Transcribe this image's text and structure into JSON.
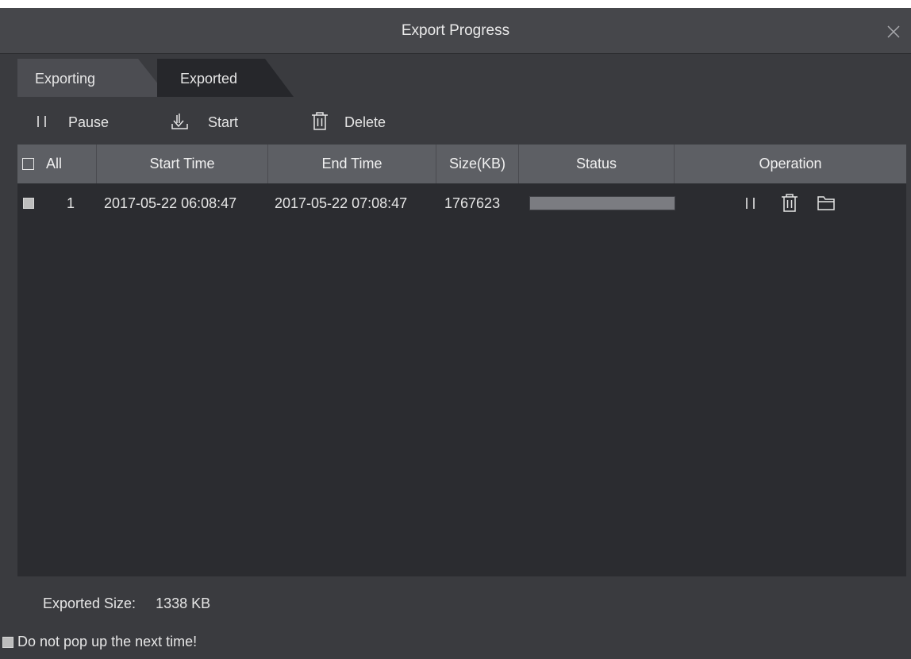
{
  "dialog": {
    "title": "Export Progress"
  },
  "tabs": [
    {
      "label": "Exporting",
      "active": false
    },
    {
      "label": "Exported",
      "active": true
    }
  ],
  "toolbar": {
    "pause_label": "Pause",
    "start_label": "Start",
    "delete_label": "Delete"
  },
  "table": {
    "columns": [
      "All",
      "Start Time",
      "End Time",
      "Size(KB)",
      "Status",
      "Operation"
    ],
    "rows": [
      {
        "index": "1",
        "start_time": "2017-05-22 06:08:47",
        "end_time": "2017-05-22 07:08:47",
        "size_kb": "1767623",
        "status_progress": 1.0,
        "operations": [
          "pause-icon",
          "trash-icon",
          "folder-icon"
        ]
      }
    ]
  },
  "footer": {
    "exported_size_label": "Exported Size:",
    "exported_size_value": "1338 KB",
    "no_popup_label": "Do not pop up the next time!"
  },
  "colors": {
    "background": "#3a3b3f",
    "titlebar": "#46474b",
    "grid_background": "#2b2c30",
    "grid_header": "#5d5f64",
    "tab_inactive": "#4c4d52",
    "tab_active": "#26272b",
    "progress_fill": "#7b7c81",
    "text": "#e6e6e6"
  }
}
